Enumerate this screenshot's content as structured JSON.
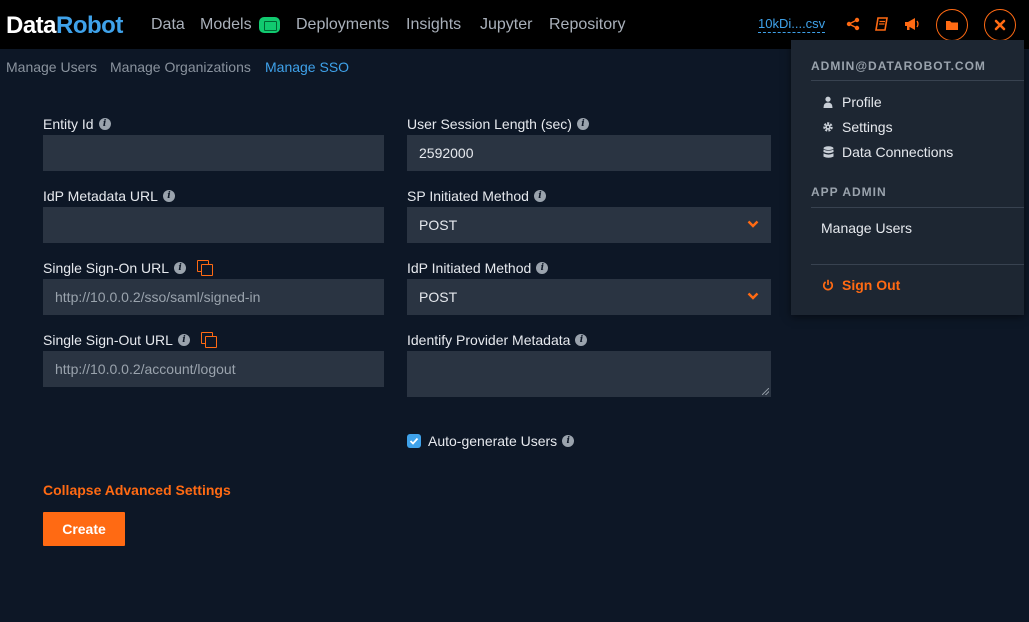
{
  "header": {
    "logo_part1": "Data",
    "logo_part2": "Robot",
    "nav": [
      "Data",
      "Models",
      "Deployments",
      "Insights",
      "Jupyter",
      "Repository"
    ],
    "dataset_link": "10kDi....csv",
    "icons": [
      "share-icon",
      "book-icon",
      "megaphone-icon",
      "folder-icon",
      "close-icon"
    ]
  },
  "subnav": {
    "items": [
      "Manage Users",
      "Manage Organizations",
      "Manage SSO"
    ],
    "active": "Manage SSO"
  },
  "form": {
    "entity_id": {
      "label": "Entity Id",
      "value": ""
    },
    "idp_metadata_url": {
      "label": "IdP Metadata URL",
      "value": ""
    },
    "sso_url": {
      "label": "Single Sign-On URL",
      "value": "http://10.0.0.2/sso/saml/signed-in"
    },
    "slo_url": {
      "label": "Single Sign-Out URL",
      "value": "http://10.0.0.2/account/logout"
    },
    "session_length": {
      "label": "User Session Length (sec)",
      "value": "2592000"
    },
    "sp_method": {
      "label": "SP Initiated Method",
      "value": "POST"
    },
    "idp_method": {
      "label": "IdP Initiated Method",
      "value": "POST"
    },
    "provider_metadata": {
      "label": "Identify Provider Metadata",
      "value": ""
    },
    "auto_generate": {
      "label": "Auto-generate Users",
      "checked": true
    },
    "advanced_link": "Collapse Advanced Settings",
    "create_button": "Create"
  },
  "menu": {
    "account": "ADMIN@DATAROBOT.COM",
    "items": [
      "Profile",
      "Settings",
      "Data Connections"
    ],
    "section_admin": "APP ADMIN",
    "admin_items": [
      "Manage Users"
    ],
    "sign_out": "Sign Out"
  },
  "colors": {
    "accent": "#ff6a13",
    "link": "#3fa2ea",
    "background": "#0d1726",
    "field": "#2a3442",
    "gpu_badge": "#11c96f"
  }
}
